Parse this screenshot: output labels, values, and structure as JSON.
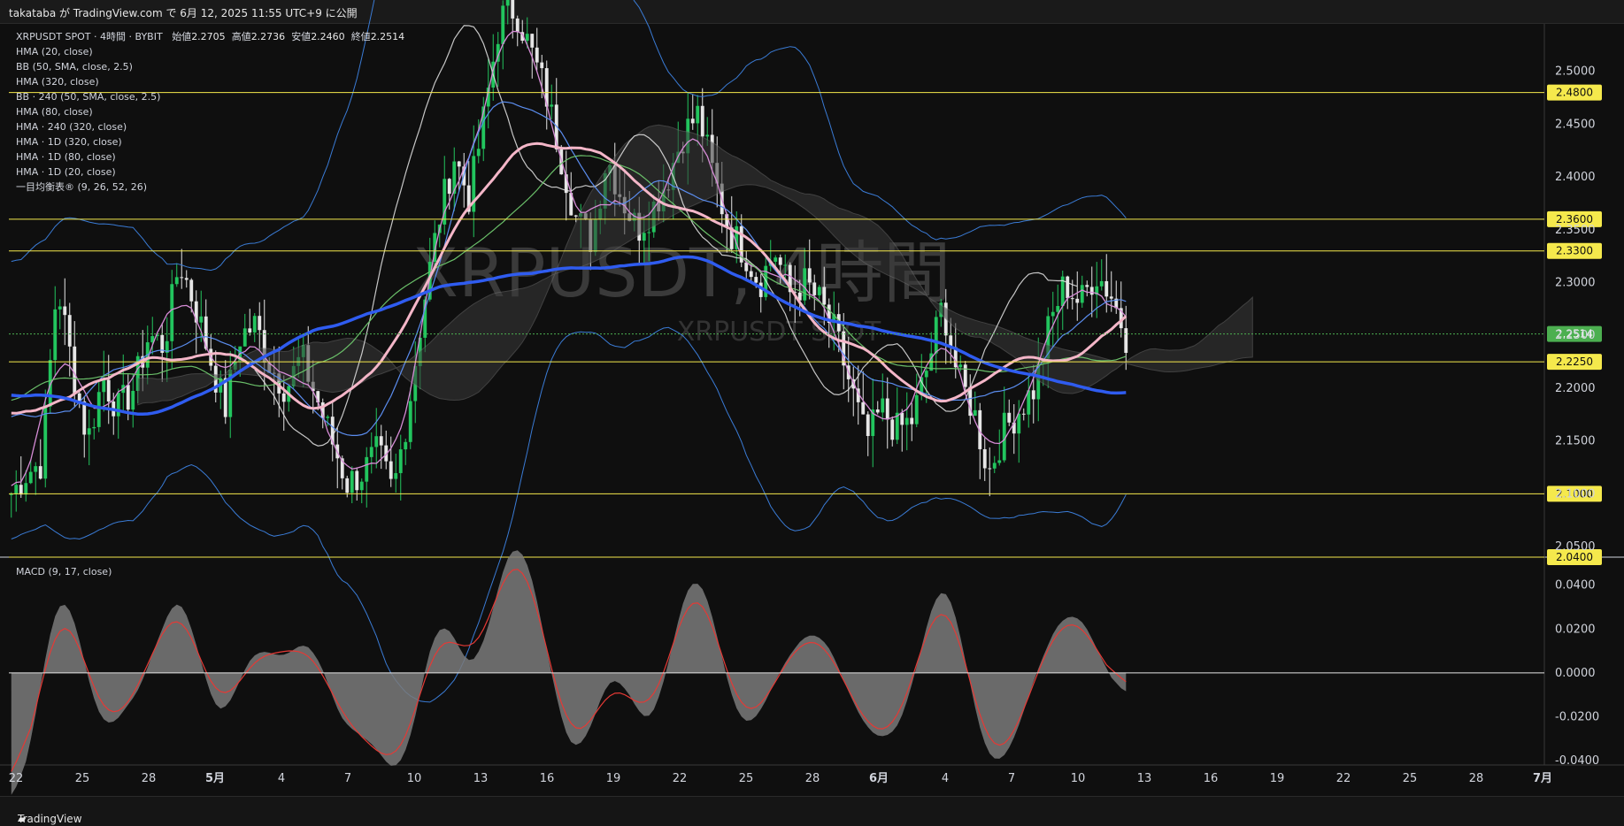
{
  "header": {
    "published_text": "takataba が TradingView.com で 6月 12, 2025 11:55 UTC+9 に公開"
  },
  "legend": {
    "symbol_line": "XRPUSDT SPOT · 4時間 · BYBIT",
    "ohlc": {
      "open_label": "始値",
      "open": "2.2705",
      "high_label": "高値",
      "high": "2.2736",
      "low_label": "安値",
      "low": "2.2460",
      "close_label": "終値",
      "close": "2.2514"
    },
    "indicators": [
      "HMA (20, close)",
      "BB (50, SMA, close, 2.5)",
      "HMA (320, close)",
      "BB · 240 (50, SMA, close, 2.5)",
      "HMA (80, close)",
      "HMA · 240 (320, close)",
      "HMA · 1D (320, close)",
      "HMA · 1D (80, close)",
      "HMA · 1D (20, close)",
      "一目均衡表® (9, 26, 52, 26)"
    ]
  },
  "watermark": {
    "big": "XRPUSDT, 4時間",
    "small": "XRPUSDT SPOT"
  },
  "macd_label": "MACD (9, 17, close)",
  "footer": {
    "brand": "TradingView"
  },
  "colors": {
    "bull": "#22c55e",
    "bear": "#e6e6e6",
    "hline": "#f5e94c",
    "price_tag": "#4caf50",
    "hma_pink": "#f4b6c8",
    "hma_blue": "#2f5cf0",
    "hma_green": "#6abf69",
    "bb": "#3a7bd5",
    "cloud": "#3a3a3a"
  },
  "chart_data": {
    "type": "candlestick",
    "price_axis": {
      "ticks": [
        "2.5000",
        "2.4500",
        "2.4000",
        "2.3500",
        "2.3000",
        "2.2500",
        "2.2000",
        "2.1500",
        "2.1000",
        "2.0500"
      ],
      "ylim": [
        2.04,
        2.545
      ]
    },
    "horizontal_levels": [
      {
        "value": 2.48,
        "label": "2.4800"
      },
      {
        "value": 2.36,
        "label": "2.3600"
      },
      {
        "value": 2.33,
        "label": "2.3300"
      },
      {
        "value": 2.225,
        "label": "2.2250"
      },
      {
        "value": 2.1,
        "label": "2.1000"
      },
      {
        "value": 2.04,
        "label": "2.0400"
      }
    ],
    "last_price": {
      "value": 2.2514,
      "label": "2.2514"
    },
    "time_axis": [
      "22",
      "25",
      "28",
      "5月",
      "4",
      "7",
      "10",
      "13",
      "16",
      "19",
      "22",
      "25",
      "28",
      "6月",
      "4",
      "7",
      "10",
      "13",
      "16",
      "19",
      "22",
      "25",
      "28",
      "7月"
    ],
    "macd": {
      "ticks": [
        "0.0400",
        "0.0200",
        "0.0000",
        "-0.0200",
        "-0.0400"
      ],
      "ylim": [
        -0.042,
        0.052
      ]
    },
    "price_path": [
      2.1,
      2.12,
      2.13,
      2.3,
      2.22,
      2.15,
      2.21,
      2.18,
      2.2,
      2.25,
      2.24,
      2.32,
      2.28,
      2.23,
      2.18,
      2.25,
      2.26,
      2.22,
      2.2,
      2.23,
      2.19,
      2.15,
      2.11,
      2.12,
      2.14,
      2.1,
      2.18,
      2.28,
      2.36,
      2.42,
      2.38,
      2.46,
      2.55,
      2.56,
      2.52,
      2.48,
      2.42,
      2.36,
      2.34,
      2.42,
      2.38,
      2.35,
      2.37,
      2.4,
      2.44,
      2.46,
      2.4,
      2.35,
      2.33,
      2.3,
      2.33,
      2.29,
      2.3,
      2.28,
      2.25,
      2.2,
      2.15,
      2.18,
      2.16,
      2.17,
      2.22,
      2.28,
      2.21,
      2.18,
      2.12,
      2.16,
      2.18,
      2.2,
      2.26,
      2.3,
      2.28,
      2.31,
      2.29,
      2.25
    ]
  }
}
